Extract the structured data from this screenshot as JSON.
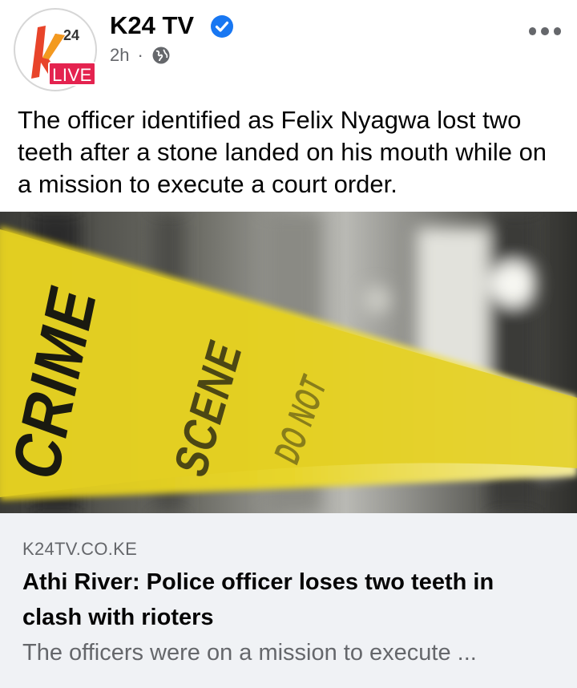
{
  "header": {
    "page_name": "K24 TV",
    "timestamp": "2h",
    "separator": "·",
    "live_badge": "LIVE",
    "logo_text": "24",
    "verified_icon": "verified-check-icon",
    "audience_icon": "globe-icon",
    "more_icon": "more-options-icon"
  },
  "post": {
    "caption": "The officer identified as Felix Nyagwa lost two teeth after a stone landed on his mouth while on a mission to execute a court order."
  },
  "photo": {
    "tape_text": "CRIME SCENE DO NOT CROSS",
    "tape_color": "#e7d52a"
  },
  "link_preview": {
    "domain": "K24TV.CO.KE",
    "title": "Athi River: Police officer loses two teeth in clash with rioters",
    "description": "The officers were on a mission to execute ..."
  },
  "colors": {
    "brand_red": "#e4234f",
    "verified_blue": "#1877f2",
    "secondary_text": "#65676b",
    "preview_bg": "#f0f2f5"
  }
}
